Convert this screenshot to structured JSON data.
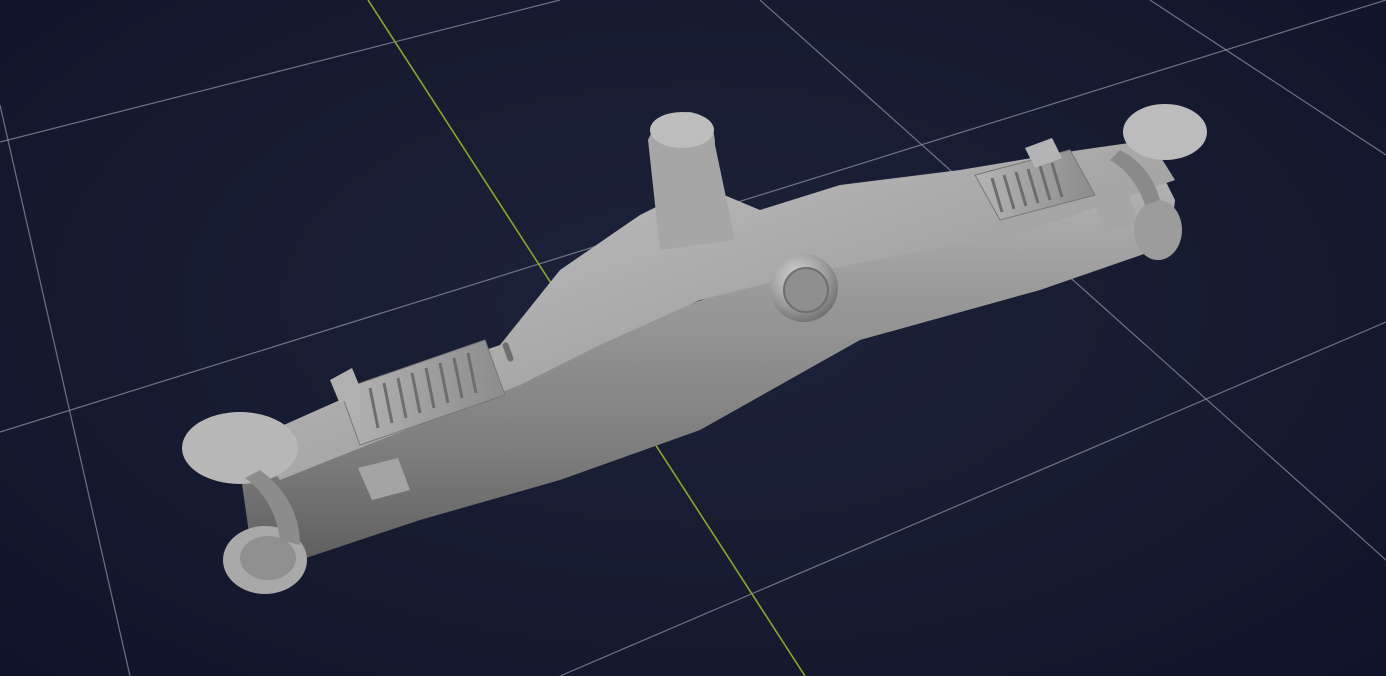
{
  "viewport": {
    "background_color": "#161b30",
    "grid_color": "#8c90a0",
    "axis_color": "#8aa62a",
    "model": {
      "description_icon": "part-model",
      "material_color": "#9a9a9a"
    }
  }
}
